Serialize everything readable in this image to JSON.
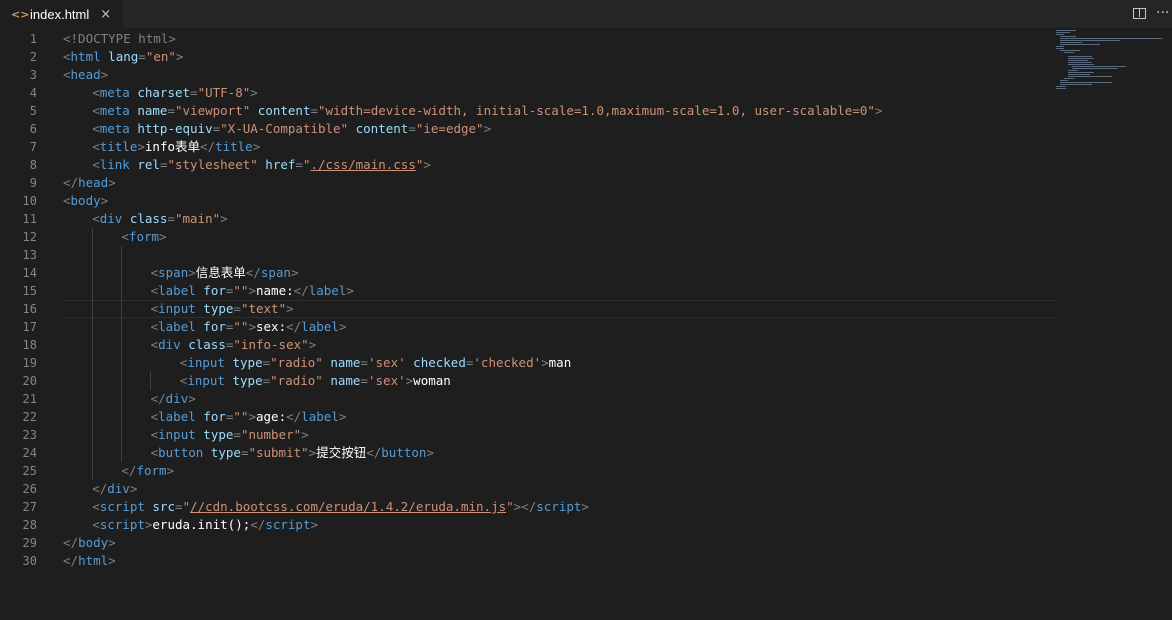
{
  "tab": {
    "icon": "<>",
    "title": "index.html",
    "close": "×"
  },
  "editor_actions": {
    "split_editor_icon": "split-editor-icon",
    "more_actions": "···"
  },
  "line_numbers": [
    "1",
    "2",
    "3",
    "4",
    "5",
    "6",
    "7",
    "8",
    "9",
    "10",
    "11",
    "12",
    "13",
    "14",
    "15",
    "16",
    "17",
    "18",
    "19",
    "20",
    "21",
    "22",
    "23",
    "24",
    "25",
    "26",
    "27",
    "28",
    "29",
    "30"
  ],
  "code": {
    "l1": {
      "a": "<!DOCTYPE html>"
    },
    "l2": {
      "a": "<",
      "t": "html",
      "at": " lang",
      "eq": "=",
      "s": "\"en\"",
      "e": ">"
    },
    "l3": {
      "a": "<",
      "t": "head",
      "e": ">"
    },
    "l4": {
      "a": "<",
      "t": "meta",
      "at": " charset",
      "eq": "=",
      "s": "\"UTF-8\"",
      "e": ">"
    },
    "l5": {
      "a": "<",
      "t": "meta",
      "at1": " name",
      "eq1": "=",
      "s1": "\"viewport\"",
      "at2": " content",
      "eq2": "=",
      "s2": "\"width=device-width, initial-scale=1.0,maximum-scale=1.0, user-scalable=0\"",
      "e": ">"
    },
    "l6": {
      "a": "<",
      "t": "meta",
      "at1": " http-equiv",
      "eq1": "=",
      "s1": "\"X-UA-Compatible\"",
      "at2": " content",
      "eq2": "=",
      "s2": "\"ie=edge\"",
      "e": ">"
    },
    "l7": {
      "a": "<",
      "t": "title",
      "e": ">",
      "x": "info表单",
      "c1": "</",
      "t2": "title",
      "c2": ">"
    },
    "l8": {
      "a": "<",
      "t": "link",
      "at1": " rel",
      "eq1": "=",
      "s1": "\"stylesheet\"",
      "at2": " href",
      "eq2": "=",
      "q1": "\"",
      "s2": "./css/main.css",
      "q2": "\"",
      "e": ">"
    },
    "l9": {
      "a": "</",
      "t": "head",
      "e": ">"
    },
    "l10": {
      "a": "<",
      "t": "body",
      "e": ">"
    },
    "l11": {
      "a": "<",
      "t": "div",
      "at": " class",
      "eq": "=",
      "s": "\"main\"",
      "e": ">"
    },
    "l12": {
      "a": "<",
      "t": "form",
      "e": ">"
    },
    "l14": {
      "a": "<",
      "t": "span",
      "e": ">",
      "x": "信息表单",
      "c1": "</",
      "t2": "span",
      "c2": ">"
    },
    "l15": {
      "a": "<",
      "t": "label",
      "at": " for",
      "eq": "=",
      "s": "\"\"",
      "e": ">",
      "x": "name:",
      "c1": "</",
      "t2": "label",
      "c2": ">"
    },
    "l16": {
      "a": "<",
      "t": "input",
      "at": " type",
      "eq": "=",
      "s": "\"text\"",
      "e": ">"
    },
    "l17": {
      "a": "<",
      "t": "label",
      "at": " for",
      "eq": "=",
      "s": "\"\"",
      "e": ">",
      "x": "sex:",
      "c1": "</",
      "t2": "label",
      "c2": ">"
    },
    "l18": {
      "a": "<",
      "t": "div",
      "at": " class",
      "eq": "=",
      "s": "\"info-sex\"",
      "e": ">"
    },
    "l19": {
      "a": "<",
      "t": "input",
      "at1": " type",
      "eq1": "=",
      "s1": "\"radio\"",
      "at2": " name",
      "eq2": "=",
      "s2": "'sex'",
      "at3": " checked",
      "eq3": "=",
      "s3": "'checked'",
      "e": ">",
      "x": "man"
    },
    "l20": {
      "a": "<",
      "t": "input",
      "at1": " type",
      "eq1": "=",
      "s1": "\"radio\"",
      "at2": " name",
      "eq2": "=",
      "s2": "'sex'",
      "e": ">",
      "x": "woman"
    },
    "l21": {
      "a": "</",
      "t": "div",
      "e": ">"
    },
    "l22": {
      "a": "<",
      "t": "label",
      "at": " for",
      "eq": "=",
      "s": "\"\"",
      "e": ">",
      "x": "age:",
      "c1": "</",
      "t2": "label",
      "c2": ">"
    },
    "l23": {
      "a": "<",
      "t": "input",
      "at": " type",
      "eq": "=",
      "s": "\"number\"",
      "e": ">"
    },
    "l24": {
      "a": "<",
      "t": "button",
      "at": " type",
      "eq": "=",
      "s": "\"submit\"",
      "e": ">",
      "x": "提交按钮",
      "c1": "</",
      "t2": "button",
      "c2": ">"
    },
    "l25": {
      "a": "</",
      "t": "form",
      "e": ">"
    },
    "l26": {
      "a": "</",
      "t": "div",
      "e": ">"
    },
    "l27": {
      "a": "<",
      "t": "script",
      "at": " src",
      "eq": "=",
      "q1": "\"",
      "s": "//cdn.bootcss.com/eruda/1.4.2/eruda.min.js",
      "q2": "\"",
      "e": ">",
      "c1": "</",
      "t2": "script",
      "c2": ">"
    },
    "l28": {
      "a": "<",
      "t": "script",
      "e": ">",
      "x": "eruda.init();",
      "c1": "</",
      "t2": "script",
      "c2": ">"
    },
    "l29": {
      "a": "</",
      "t": "body",
      "e": ">"
    },
    "l30": {
      "a": "</",
      "t": "html",
      "e": ">"
    }
  },
  "colors": {
    "background": "#1e1e1e",
    "tag": "#569cd6",
    "attribute": "#9cdcfe",
    "string": "#ce9178",
    "bracket": "#808080",
    "text": "#ffffff",
    "line_number": "#858585"
  }
}
